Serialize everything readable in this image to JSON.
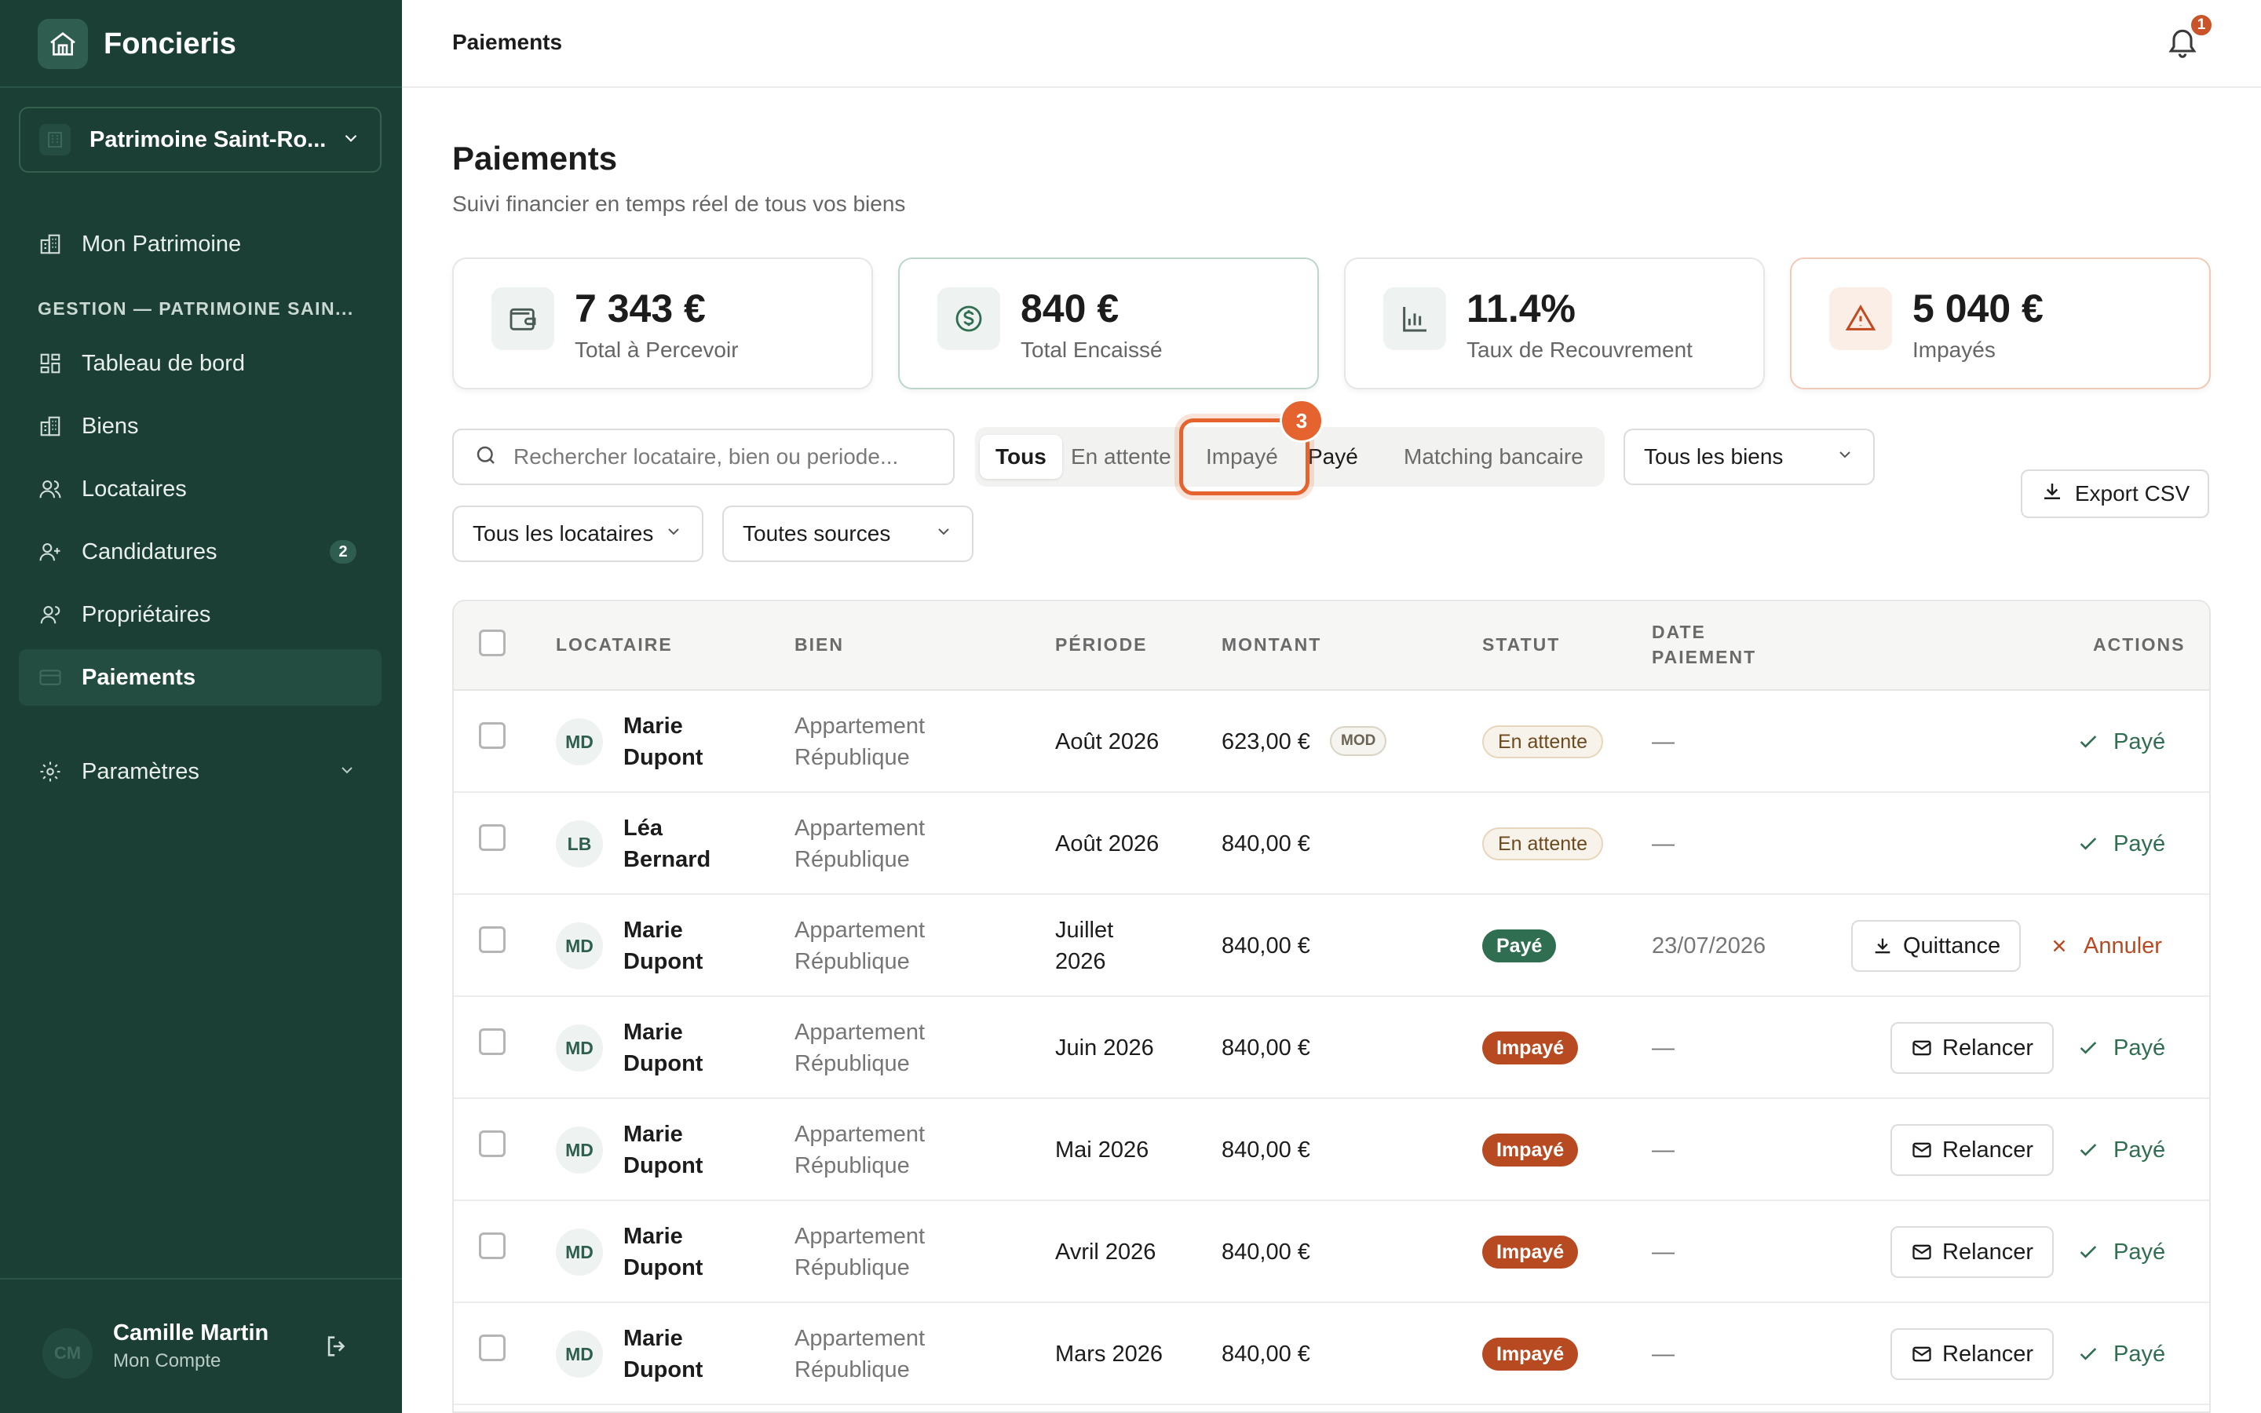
{
  "brand": {
    "name": "Foncieris"
  },
  "workspace": {
    "name": "Patrimoine Saint-Ro..."
  },
  "sidebar": {
    "top_item": "Mon Patrimoine",
    "section_label": "GESTION — PATRIMOINE SAIN...",
    "items": [
      {
        "label": "Tableau de bord"
      },
      {
        "label": "Biens"
      },
      {
        "label": "Locataires"
      },
      {
        "label": "Candidatures",
        "badge": "2"
      },
      {
        "label": "Propriétaires"
      },
      {
        "label": "Paiements"
      }
    ],
    "settings": "Paramètres"
  },
  "account": {
    "initials": "CM",
    "name": "Camille Martin",
    "subtitle": "Mon Compte"
  },
  "header": {
    "title": "Paiements",
    "notifications": "1"
  },
  "page": {
    "title": "Paiements",
    "subtitle": "Suivi financier en temps réel de tous vos biens"
  },
  "kpis": [
    {
      "value": "7 343 €",
      "label": "Total à Percevoir"
    },
    {
      "value": "840 €",
      "label": "Total Encaissé"
    },
    {
      "value": "11.4%",
      "label": "Taux de Recouvrement"
    },
    {
      "value": "5 040 €",
      "label": "Impayés"
    }
  ],
  "filters": {
    "search_placeholder": "Rechercher locataire, bien ou periode...",
    "tabs": [
      "Tous",
      "En attente",
      "Impayé",
      "Payé",
      "Matching bancaire"
    ],
    "highlight_badge": "3",
    "properties_select": "Tous les biens",
    "tenants_select": "Tous les locataires",
    "sources_select": "Toutes sources",
    "export_label": "Export CSV"
  },
  "colors": {
    "sidebar": "#1b3f35",
    "accent_green": "#2f6e50",
    "accent_orange": "#e4632f",
    "unpaid": "#b84a21"
  },
  "table": {
    "headers": {
      "tenant": "LOCATAIRE",
      "property": "BIEN",
      "period": "PÉRIODE",
      "amount": "MONTANT",
      "status": "STATUT",
      "date_line1": "DATE",
      "date_line2": "PAIEMENT",
      "actions": "ACTIONS"
    },
    "rows": [
      {
        "initials": "MD",
        "first": "Marie",
        "last": "Dupont",
        "prop1": "Appartement",
        "prop2": "République",
        "period1": "Août 2026",
        "period2": "",
        "amount": "623,00 €",
        "mod": "MOD",
        "status": "En attente",
        "date": "—",
        "primary": "",
        "secondary": "Payé"
      },
      {
        "initials": "LB",
        "first": "Léa",
        "last": "Bernard",
        "prop1": "Appartement",
        "prop2": "République",
        "period1": "Août 2026",
        "period2": "",
        "amount": "840,00 €",
        "mod": "",
        "status": "En attente",
        "date": "—",
        "primary": "",
        "secondary": "Payé"
      },
      {
        "initials": "MD",
        "first": "Marie",
        "last": "Dupont",
        "prop1": "Appartement",
        "prop2": "République",
        "period1": "Juillet",
        "period2": "2026",
        "amount": "840,00 €",
        "mod": "",
        "status": "Payé",
        "date": "23/07/2026",
        "primary": "Quittance",
        "secondary": "Annuler"
      },
      {
        "initials": "MD",
        "first": "Marie",
        "last": "Dupont",
        "prop1": "Appartement",
        "prop2": "République",
        "period1": "Juin 2026",
        "period2": "",
        "amount": "840,00 €",
        "mod": "",
        "status": "Impayé",
        "date": "—",
        "primary": "Relancer",
        "secondary": "Payé"
      },
      {
        "initials": "MD",
        "first": "Marie",
        "last": "Dupont",
        "prop1": "Appartement",
        "prop2": "République",
        "period1": "Mai 2026",
        "period2": "",
        "amount": "840,00 €",
        "mod": "",
        "status": "Impayé",
        "date": "—",
        "primary": "Relancer",
        "secondary": "Payé"
      },
      {
        "initials": "MD",
        "first": "Marie",
        "last": "Dupont",
        "prop1": "Appartement",
        "prop2": "République",
        "period1": "Avril 2026",
        "period2": "",
        "amount": "840,00 €",
        "mod": "",
        "status": "Impayé",
        "date": "—",
        "primary": "Relancer",
        "secondary": "Payé"
      },
      {
        "initials": "MD",
        "first": "Marie",
        "last": "Dupont",
        "prop1": "Appartement",
        "prop2": "République",
        "period1": "Mars 2026",
        "period2": "",
        "amount": "840,00 €",
        "mod": "",
        "status": "Impayé",
        "date": "—",
        "primary": "Relancer",
        "secondary": "Payé"
      }
    ]
  }
}
